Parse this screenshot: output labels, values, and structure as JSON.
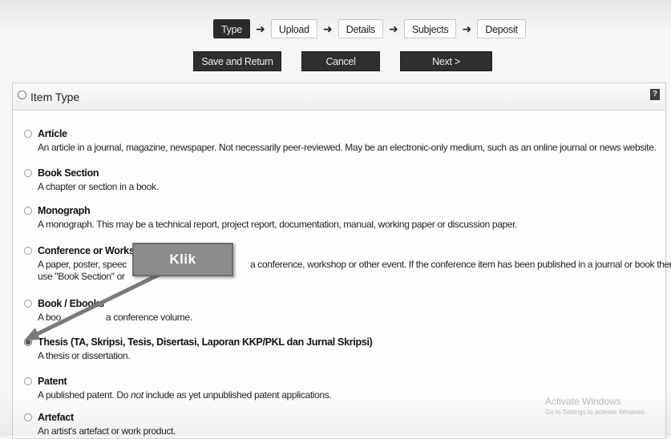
{
  "workflow": {
    "steps": [
      "Type",
      "Upload",
      "Details",
      "Subjects",
      "Deposit"
    ],
    "active_step": "Type"
  },
  "actions": {
    "save_label": "Save and Return",
    "cancel_label": "Cancel",
    "next_label": "Next >"
  },
  "panel": {
    "title": "Item Type",
    "help_icon": "?"
  },
  "item_types": [
    {
      "name": "Article",
      "description": "An article in a journal, magazine, newspaper. Not necessarily peer-reviewed. May be an electronic-only medium, such as an online journal or news website.",
      "selected": false
    },
    {
      "name": "Book Section",
      "description": "A chapter or section in a book.",
      "selected": false
    },
    {
      "name": "Monograph",
      "description": "A monograph. This may be a technical report, project report, documentation, manual, working paper or discussion paper.",
      "selected": false
    },
    {
      "name": "Conference or Worksho",
      "description": "A paper, poster, speec",
      "description_rest": "a conference, workshop or other event. If the conference item has been published in a journal or book then please",
      "description_line2": "use \"Book Section\" or",
      "selected": false
    },
    {
      "name": "Book / Ebooks",
      "description": "A boo",
      "description_rest": "a conference volume.",
      "selected": false
    },
    {
      "name": "Thesis (TA, Skripsi, Tesis, Disertasi, Laporan KKP/PKL dan Jurnal Skripsi)",
      "description": "A thesis or dissertation.",
      "selected": true
    },
    {
      "name": "Patent",
      "description_pre": "A published patent. Do ",
      "description_em": "not",
      "description_post": " include as yet unpublished patent applications.",
      "selected": false
    },
    {
      "name": "Artefact",
      "description": "An artist's artefact or work product.",
      "selected": false
    }
  ],
  "annotation": {
    "label": "Klik"
  },
  "watermark": {
    "title": "Activate Windows",
    "subtitle": "Go to Settings to activate Windows."
  }
}
